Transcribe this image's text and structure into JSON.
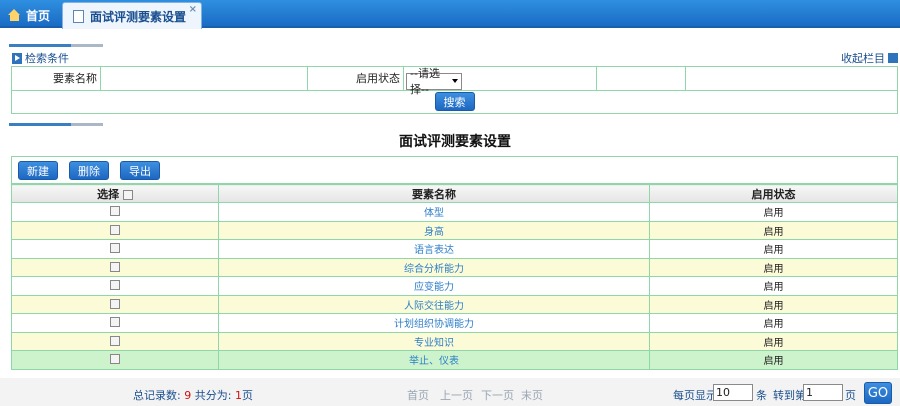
{
  "tabs": {
    "home": "首页",
    "active": "面试评测要素设置",
    "close": "×"
  },
  "search": {
    "header": "检索条件",
    "collapse": "收起栏目",
    "name_label": "要素名称",
    "name_value": "",
    "status_label": "启用状态",
    "status_selected": "--请选择--",
    "search_button": "搜索"
  },
  "main": {
    "title": "面试评测要素设置"
  },
  "toolbar": {
    "new": "新建",
    "delete": "删除",
    "export": "导出"
  },
  "table": {
    "headers": [
      "选择",
      "要素名称",
      "启用状态"
    ],
    "rows": [
      {
        "name": "体型",
        "status": "启用"
      },
      {
        "name": "身高",
        "status": "启用"
      },
      {
        "name": "语言表达",
        "status": "启用"
      },
      {
        "name": "综合分析能力",
        "status": "启用"
      },
      {
        "name": "应变能力",
        "status": "启用"
      },
      {
        "name": "人际交往能力",
        "status": "启用"
      },
      {
        "name": "计划组织协调能力",
        "status": "启用"
      },
      {
        "name": "专业知识",
        "status": "启用"
      },
      {
        "name": "举止、仪表",
        "status": "启用"
      }
    ]
  },
  "pager": {
    "total_label": "总记录数:",
    "total": "9",
    "pages_label": "共分为:",
    "pages": "1",
    "page_unit": "页",
    "first": "首页",
    "prev": "上一页",
    "next": "下一页",
    "last": "末页",
    "per_page_label": "每页显示",
    "per_page": "10",
    "per_page_unit": "条",
    "goto_label": "转到第",
    "goto_page": "1",
    "goto_unit": "页",
    "go": "GO"
  },
  "colors": {
    "accent": "#1d68c2",
    "border": "#8fd7a8",
    "row_alt": "#fbfbd8",
    "row_selected": "#ccf3cc",
    "link": "#2c7ec8"
  }
}
